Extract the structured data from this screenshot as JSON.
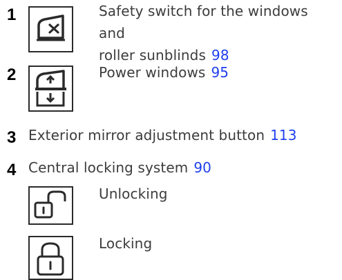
{
  "items": [
    {
      "number": "1",
      "text_line1": "Safety switch for the windows and",
      "text_line2": "roller sunblinds",
      "page_ref": "98",
      "icon": "window-lock-switch-icon"
    },
    {
      "number": "2",
      "text": "Power windows",
      "page_ref": "95",
      "icon": "power-window-switch-icon"
    },
    {
      "number": "3",
      "text": "Exterior mirror adjustment button",
      "page_ref": "113"
    },
    {
      "number": "4",
      "text": "Central locking system",
      "page_ref": "90",
      "sub_items": [
        {
          "text": "Unlocking",
          "icon": "unlock-icon"
        },
        {
          "text": "Locking",
          "icon": "lock-icon"
        }
      ]
    }
  ],
  "colors": {
    "text": "#3c3c3c",
    "number": "#000000",
    "page_ref": "#1f3ff0",
    "icon_stroke": "#2a2a2a"
  }
}
